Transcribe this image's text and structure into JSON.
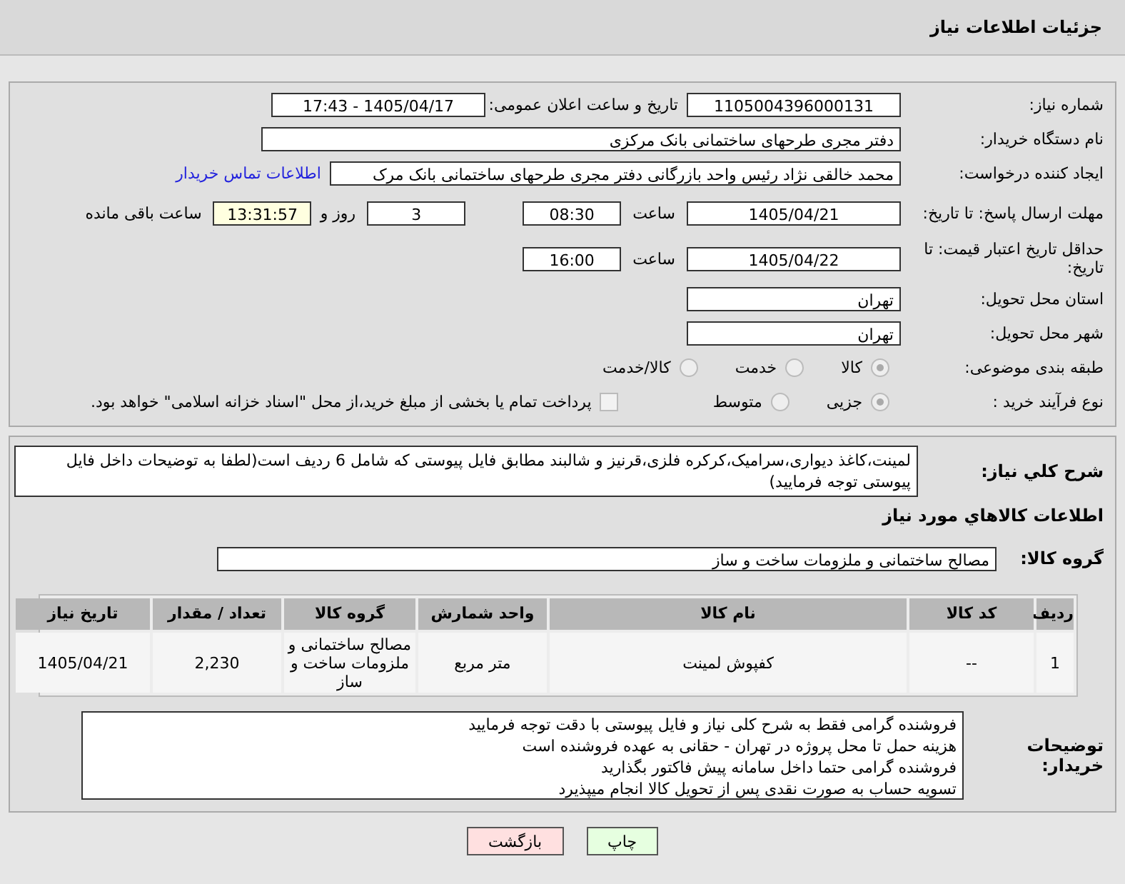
{
  "page_title": "جزئیات اطلاعات نیاز",
  "need_info": {
    "need_number": {
      "label": "شماره نیاز:",
      "value": "1105004396000131"
    },
    "announce_datetime": {
      "label": "تاریخ و ساعت اعلان عمومی:",
      "value": "1405/04/17 - 17:43"
    },
    "buyer_org": {
      "label": "نام دستگاه خریدار:",
      "value": "دفتر مجری طرحهای ساختمانی بانک مرکزی"
    },
    "requester": {
      "label": "ایجاد کننده درخواست:",
      "value": "محمد خالقی نژاد رئیس واحد بازرگانی دفتر مجری طرحهای ساختمانی بانک مرک",
      "contact_link": "اطلاعات تماس خریدار"
    },
    "reply_deadline": {
      "label": "مهلت ارسال پاسخ: تا تاریخ:",
      "date": "1405/04/21",
      "time_label": "ساعت",
      "time": "08:30",
      "days": "3",
      "days_label": "روز و",
      "remaining": "13:31:57",
      "remaining_label": "ساعت باقی مانده"
    },
    "price_validity": {
      "label": "حداقل تاریخ اعتبار قیمت: تا تاریخ:",
      "date": "1405/04/22",
      "time_label": "ساعت",
      "time": "16:00"
    },
    "delivery_province": {
      "label": "استان محل تحویل:",
      "value": "تهران"
    },
    "delivery_city": {
      "label": "شهر محل تحویل:",
      "value": "تهران"
    },
    "category": {
      "label": "طبقه بندی موضوعی:",
      "options": [
        {
          "label": "کالا",
          "selected": true
        },
        {
          "label": "خدمت",
          "selected": false
        },
        {
          "label": "کالا/خدمت",
          "selected": false
        }
      ]
    },
    "purchase_process": {
      "label": "نوع فرآیند خرید :",
      "options": [
        {
          "label": "جزیی",
          "selected": true
        },
        {
          "label": "متوسط",
          "selected": false
        }
      ],
      "payment_option": {
        "label": "پرداخت تمام یا بخشی از مبلغ خرید،از محل \"اسناد خزانه اسلامی\" خواهد بود.",
        "checked": false
      }
    }
  },
  "details": {
    "description": {
      "label": "شرح کلي نياز:",
      "value": "لمینت،کاغذ دیواری،سرامیک،کرکره فلزی،قرنیز و شالبند مطابق فایل پیوستی که شامل 6 ردیف است(لطفا به توضیحات داخل فایل پیوستی توجه فرمایید)"
    },
    "goods_heading": "اطلاعات کالاهاي مورد نياز",
    "goods_group": {
      "label": "گروه کالا:",
      "value": "مصالح ساختمانی و ملزومات ساخت و ساز"
    },
    "table": {
      "columns": [
        "ردیف",
        "کد کالا",
        "نام کالا",
        "واحد شمارش",
        "گروه کالا",
        "تعداد / مقدار",
        "تاریخ نیاز"
      ],
      "rows": [
        [
          "1",
          "--",
          "کفپوش لمینت",
          "متر مربع",
          "مصالح ساختمانی و ملزومات ساخت و ساز",
          "2,230",
          "1405/04/21"
        ]
      ]
    },
    "buyer_notes": {
      "label": "توضیحات خریدار:",
      "lines": [
        "فروشنده گرامی فقط به شرح کلی نیاز و فایل پیوستی با دقت توجه فرمایید",
        "هزینه حمل تا محل پروژه در تهران - حقانی به عهده فروشنده است",
        "فروشنده گرامی حتما داخل سامانه پیش فاکتور بگذارید",
        "تسویه حساب به صورت نقدی پس از تحویل کالا  انجام میپذیرد"
      ]
    }
  },
  "buttons": [
    {
      "label": "چاپ",
      "kind": "print"
    },
    {
      "label": "بازگشت",
      "kind": "back"
    }
  ]
}
